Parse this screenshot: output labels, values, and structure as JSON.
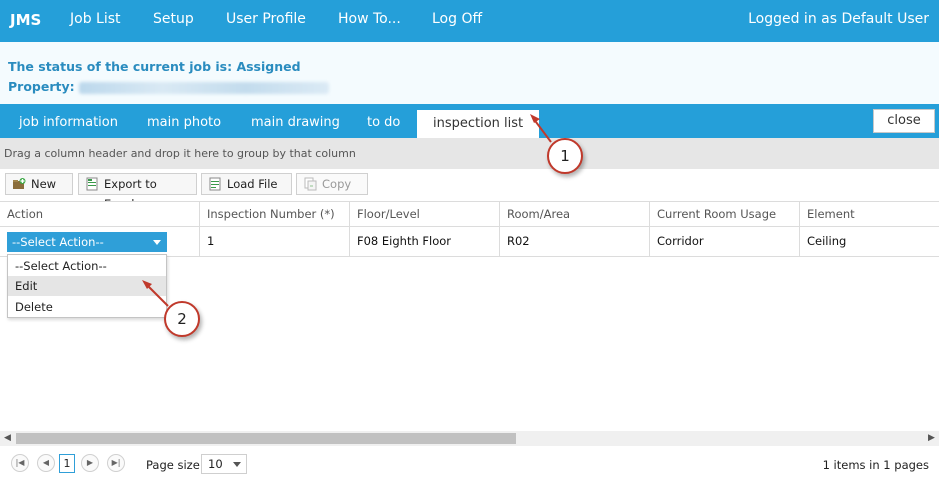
{
  "topbar": {
    "brand": "JMS",
    "nav": [
      "Job List",
      "Setup",
      "User Profile",
      "How To...",
      "Log Off"
    ],
    "user": "Logged in as Default User"
  },
  "status": {
    "line1": "The status of the current job is: Assigned",
    "property_label": "Property:"
  },
  "tabs": {
    "items": [
      "job information",
      "main photo",
      "main drawing",
      "to do",
      "inspection list"
    ],
    "active": "inspection list",
    "close": "close"
  },
  "groupbar": "Drag a column header and drop it here to group by that column",
  "toolbar": {
    "new": "New",
    "export": "Export to Excel",
    "load": "Load File",
    "copy": "Copy"
  },
  "grid": {
    "columns": [
      "Action",
      "Inspection Number (*)",
      "Floor/Level",
      "Room/Area",
      "Current Room Usage",
      "Element"
    ],
    "row": {
      "action": "--Select Action--",
      "inspection_number": "1",
      "floor": "F08 Eighth Floor",
      "room": "R02",
      "usage": "Corridor",
      "element": "Ceiling"
    }
  },
  "dropdown": {
    "options": [
      "--Select Action--",
      "Edit",
      "Delete"
    ],
    "hovered": "Edit"
  },
  "pager": {
    "current_page": "1",
    "page_size_label": "Page size:",
    "page_size": "10",
    "info": "1 items in 1 pages"
  },
  "callouts": [
    "1",
    "2"
  ],
  "colors": {
    "accent": "#259fd9",
    "callout_border": "#c0392b"
  }
}
